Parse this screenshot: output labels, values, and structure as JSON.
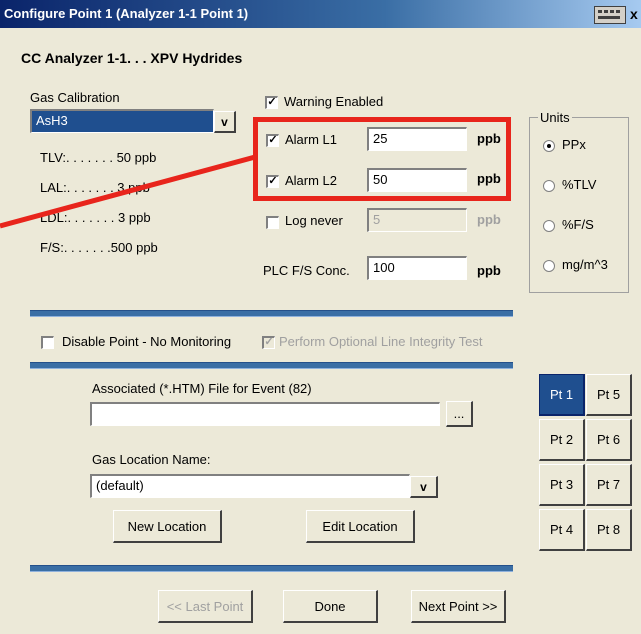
{
  "window": {
    "title": "Configure Point 1  (Analyzer 1-1  Point 1)",
    "close_glyph": "x"
  },
  "header": {
    "analyzer_label": "CC Analyzer 1-1. . .  XPV Hydrides"
  },
  "gas_calibration": {
    "label": "Gas Calibration",
    "selected": "AsH3",
    "arrow": "v",
    "tlv": "TLV:. . . . . . . 50  ppb",
    "lal": "LAL:. . . . . . . 3  ppb",
    "ldl": "LDL:. . . . . . . 3  ppb",
    "fs": "F/S:. . . . . . .500  ppb"
  },
  "alarms": {
    "warning_enabled": {
      "label": "Warning Enabled",
      "checked": true
    },
    "alarm_l1": {
      "label": "Alarm L1",
      "checked": true,
      "value": "25",
      "unit": "ppb"
    },
    "alarm_l2": {
      "label": "Alarm L2",
      "checked": true,
      "value": "50",
      "unit": "ppb"
    },
    "log_never": {
      "label": "Log never",
      "checked": false,
      "value": "5",
      "unit": "ppb"
    },
    "plc_fs": {
      "label": "PLC F/S Conc.",
      "value": "100",
      "unit": "ppb"
    }
  },
  "units": {
    "label": "Units",
    "options": [
      {
        "label": "PPx",
        "selected": true
      },
      {
        "label": "%TLV",
        "selected": false
      },
      {
        "label": "%F/S",
        "selected": false
      },
      {
        "label": "mg/m^3",
        "selected": false
      }
    ]
  },
  "options": {
    "disable_point": {
      "label": "Disable Point  - No Monitoring",
      "checked": false
    },
    "line_integrity": {
      "label": "Perform Optional Line Integrity Test",
      "checked": true
    }
  },
  "event_file": {
    "label": "Associated (*.HTM) File for Event (82)",
    "value": "",
    "browse_label": "..."
  },
  "gas_location": {
    "label": "Gas Location Name:",
    "selected": "(default)",
    "arrow": "v",
    "new_label": "New Location",
    "edit_label": "Edit Location"
  },
  "points": [
    "Pt 1",
    "Pt 5",
    "Pt 2",
    "Pt 6",
    "Pt 3",
    "Pt 7",
    "Pt 4",
    "Pt 8"
  ],
  "active_point": "Pt 1",
  "footer": {
    "last_point": "<< Last Point",
    "done": "Done",
    "next_point": "Next Point >>"
  },
  "colors": {
    "highlight": "#e8251c",
    "separator": "#3a6ea5",
    "active_point": "#1f4f8f"
  }
}
